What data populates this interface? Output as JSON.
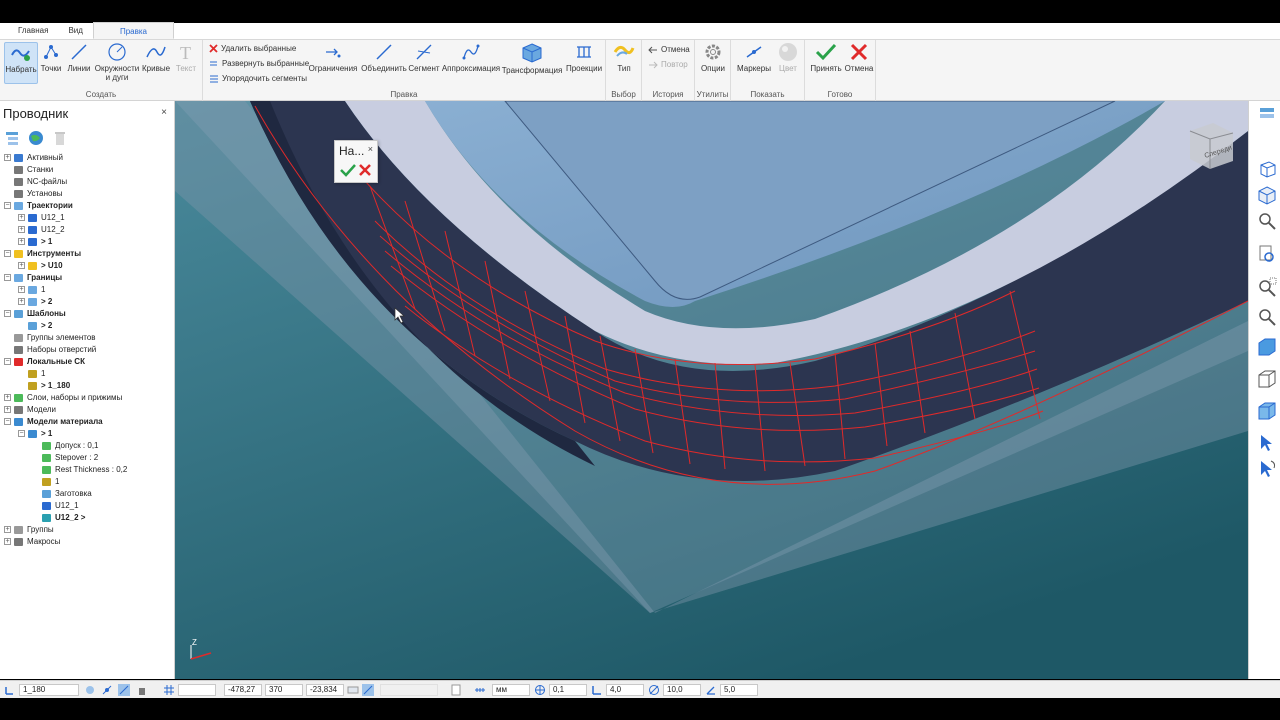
{
  "tabs": [
    "Главная",
    "Вид",
    "Правка"
  ],
  "ribbon": {
    "create": {
      "label": "Создать",
      "buttons": [
        "Набрать",
        "Точки",
        "Линии",
        "Окружности\nи дуги",
        "Кривые",
        "Текст"
      ]
    },
    "edit": {
      "label": "Правка",
      "small": [
        "Удалить выбранные",
        "Развернуть выбранные",
        "Упорядочить сегменты"
      ],
      "buttons": [
        "Ограничения",
        "Объединить",
        "Сегмент",
        "Аппроксимация",
        "Трансформация",
        "Проекции"
      ]
    },
    "select": {
      "label": "Выбор",
      "button": "Тип"
    },
    "history": {
      "label": "История",
      "undo": "Отмена",
      "redo": "Повтор"
    },
    "utils": {
      "label": "Утилиты",
      "button": "Опции"
    },
    "show": {
      "label": "Показать",
      "markers": "Маркеры",
      "color": "Цвет"
    },
    "done": {
      "label": "Готово",
      "accept": "Принять",
      "cancel": "Отмена"
    }
  },
  "explorer": {
    "title": "Проводник",
    "rows": [
      {
        "label": "Активный",
        "depth": 0,
        "bold": false
      },
      {
        "label": "Станки",
        "depth": 0,
        "bold": false
      },
      {
        "label": "NC-файлы",
        "depth": 0,
        "bold": false
      },
      {
        "label": "Установы",
        "depth": 0,
        "bold": false
      },
      {
        "label": "Траектории",
        "depth": 0,
        "bold": true
      },
      {
        "label": "U12_1",
        "depth": 1,
        "bold": false
      },
      {
        "label": "U12_2",
        "depth": 1,
        "bold": false
      },
      {
        "label": "> 1",
        "depth": 1,
        "bold": true
      },
      {
        "label": "Инструменты",
        "depth": 0,
        "bold": true
      },
      {
        "label": "> U10",
        "depth": 1,
        "bold": true
      },
      {
        "label": "Границы",
        "depth": 0,
        "bold": true
      },
      {
        "label": "1",
        "depth": 1,
        "bold": false
      },
      {
        "label": "> 2",
        "depth": 1,
        "bold": true
      },
      {
        "label": "Шаблоны",
        "depth": 0,
        "bold": true
      },
      {
        "label": "> 2",
        "depth": 1,
        "bold": true
      },
      {
        "label": "Группы элементов",
        "depth": 0,
        "bold": false
      },
      {
        "label": "Наборы отверстий",
        "depth": 0,
        "bold": false
      },
      {
        "label": "Локальные СК",
        "depth": 0,
        "bold": true
      },
      {
        "label": "1",
        "depth": 1,
        "bold": false
      },
      {
        "label": "> 1_180",
        "depth": 1,
        "bold": true
      },
      {
        "label": "Слои, наборы и прижимы",
        "depth": 0,
        "bold": false
      },
      {
        "label": "Модели",
        "depth": 0,
        "bold": false
      },
      {
        "label": "Модели материала",
        "depth": 0,
        "bold": true
      },
      {
        "label": "> 1",
        "depth": 1,
        "bold": true
      },
      {
        "label": "Допуск : 0,1",
        "depth": 2,
        "bold": false
      },
      {
        "label": "Stepover : 2",
        "depth": 2,
        "bold": false
      },
      {
        "label": "Rest Thickness : 0,2",
        "depth": 2,
        "bold": false
      },
      {
        "label": "1",
        "depth": 2,
        "bold": false
      },
      {
        "label": "Заготовка",
        "depth": 2,
        "bold": false
      },
      {
        "label": "U12_1",
        "depth": 2,
        "bold": false
      },
      {
        "label": "U12_2 >",
        "depth": 2,
        "bold": true
      },
      {
        "label": "Группы",
        "depth": 0,
        "bold": false
      },
      {
        "label": "Макросы",
        "depth": 0,
        "bold": false
      }
    ]
  },
  "popup": {
    "title": "На..."
  },
  "viewcube": {
    "label": "Спереди"
  },
  "axis": {
    "label": "Z"
  },
  "status": {
    "csys": "1_180",
    "x": "-478,27",
    "y": "370",
    "z": "-23,834",
    "units": "мм",
    "tol": "0,1",
    "thickness": "4,0",
    "diameter": "10,0",
    "angle": "5,0"
  },
  "colors": {
    "accent": "#2a6ad0",
    "edge_red": "#e02a2a",
    "accept_green": "#2aa24a"
  }
}
